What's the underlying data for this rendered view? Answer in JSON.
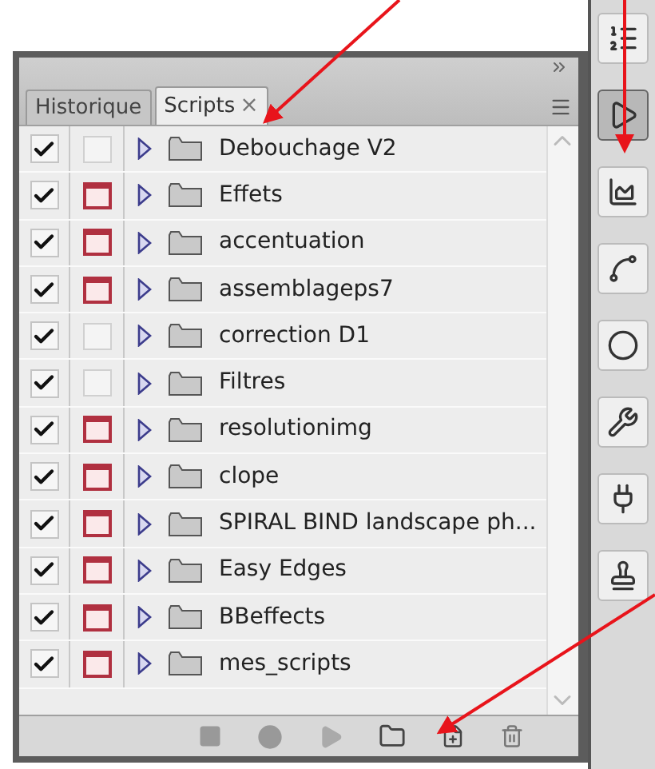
{
  "panel": {
    "tabs": [
      {
        "label": "Historique",
        "selected": false
      },
      {
        "label": "Scripts",
        "selected": true,
        "close": "×"
      }
    ],
    "actions": [
      {
        "name": "Debouchage V2",
        "checked": true,
        "dialog": false
      },
      {
        "name": "Effets",
        "checked": true,
        "dialog": true
      },
      {
        "name": "accentuation",
        "checked": true,
        "dialog": true
      },
      {
        "name": "assemblageps7",
        "checked": true,
        "dialog": true
      },
      {
        "name": "correction D1",
        "checked": true,
        "dialog": false
      },
      {
        "name": "Filtres",
        "checked": true,
        "dialog": false
      },
      {
        "name": "resolutionimg",
        "checked": true,
        "dialog": true
      },
      {
        "name": "clope",
        "checked": true,
        "dialog": true
      },
      {
        "name": "SPIRAL BIND landscape ph...",
        "checked": true,
        "dialog": true
      },
      {
        "name": "Easy Edges",
        "checked": true,
        "dialog": true
      },
      {
        "name": "BBeffects",
        "checked": true,
        "dialog": true
      },
      {
        "name": "mes_scripts",
        "checked": true,
        "dialog": true
      }
    ]
  },
  "dock": [
    {
      "kind": "history",
      "selected": false
    },
    {
      "kind": "actions",
      "selected": true
    },
    {
      "kind": "histogram",
      "selected": false
    },
    {
      "kind": "paths",
      "selected": false
    },
    {
      "kind": "sphere",
      "selected": false
    },
    {
      "kind": "tools",
      "selected": false
    },
    {
      "kind": "plugin",
      "selected": false
    },
    {
      "kind": "stamp",
      "selected": false
    }
  ]
}
